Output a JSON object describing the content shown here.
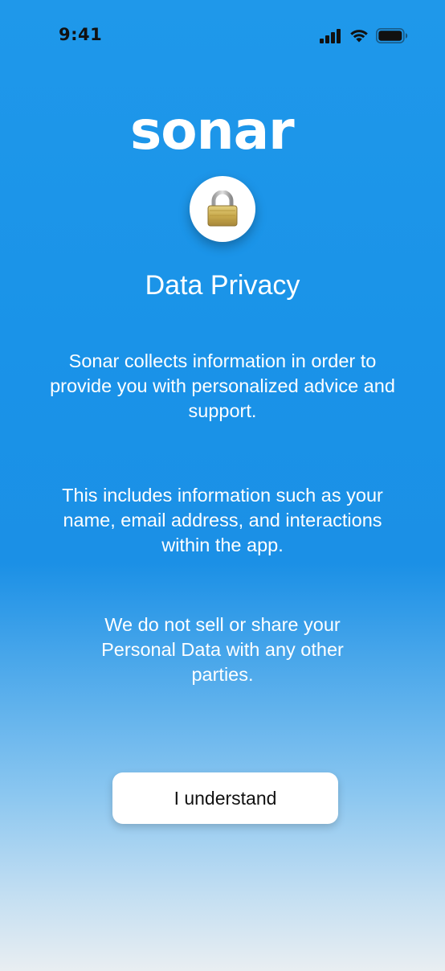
{
  "status_bar": {
    "time": "9:41",
    "icons": [
      "cellular-signal-icon",
      "wifi-icon",
      "battery-icon"
    ]
  },
  "brand": {
    "logo_text": "sonar",
    "logo_color": "#ffffff"
  },
  "lock_icon": "lock-icon",
  "title": "Data Privacy",
  "paragraphs": [
    "Sonar collects information in order to provide you with personalized advice and support.",
    "This includes information such as your name, email address, and interactions within the app.",
    "We do not sell or share your Personal Data with any other parties."
  ],
  "cta": {
    "label": "I understand"
  },
  "colors": {
    "background_top": "#1f98ea",
    "background_bottom": "#e9eef2",
    "text": "#ffffff",
    "button_bg": "#ffffff",
    "button_text": "#111111"
  }
}
